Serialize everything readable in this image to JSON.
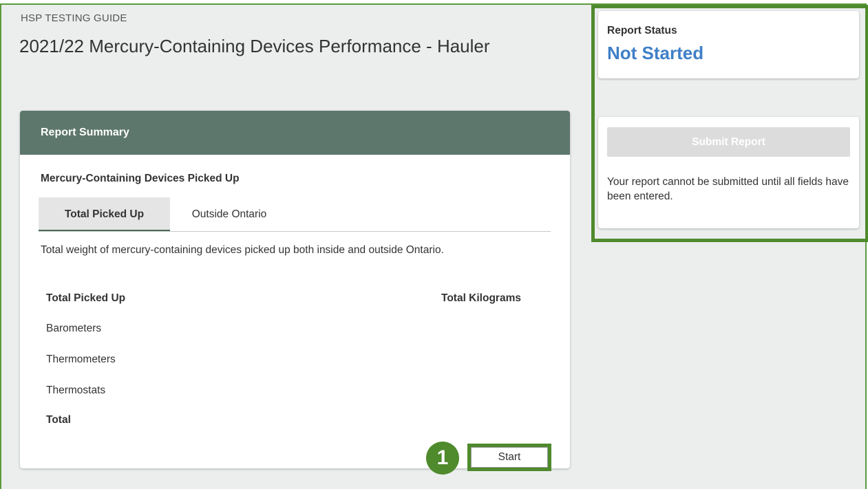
{
  "header": {
    "eyebrow": "HSP TESTING GUIDE",
    "title": "2021/22 Mercury-Containing Devices Performance - Hauler"
  },
  "report_summary": {
    "heading": "Report Summary",
    "section_title": "Mercury-Containing Devices Picked Up",
    "tabs": [
      {
        "label": "Total Picked Up",
        "active": true
      },
      {
        "label": "Outside Ontario",
        "active": false
      }
    ],
    "description": "Total weight of mercury-containing devices picked up both inside and outside Ontario.",
    "table": {
      "col_left": "Total Picked Up",
      "col_right": "Total Kilograms",
      "rows": [
        "Barometers",
        "Thermometers",
        "Thermostats",
        "Total"
      ]
    },
    "step_number": "1",
    "start_label": "Start"
  },
  "sidebar": {
    "status_label": "Report Status",
    "status_value": "Not Started",
    "submit_label": "Submit Report",
    "submit_note": "Your report cannot be submitted until all fields have been entered."
  },
  "colors": {
    "header_bg": "#5e776c",
    "highlight_green": "#4f8a2d",
    "status_blue": "#3f7fc7",
    "page_bg": "#ebeeed"
  }
}
